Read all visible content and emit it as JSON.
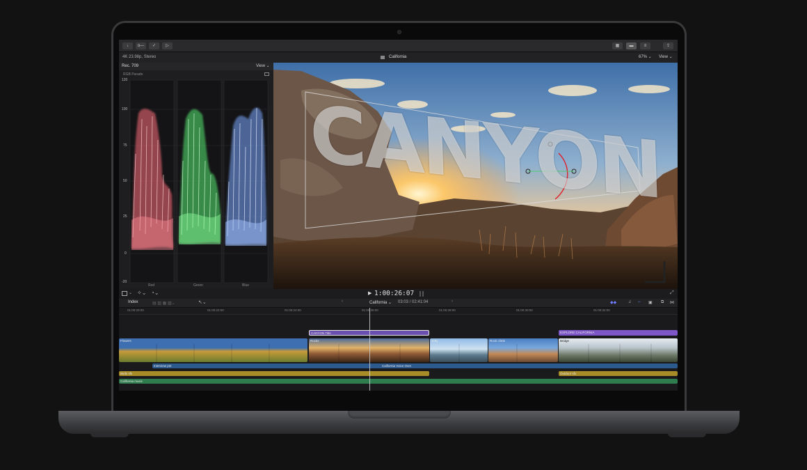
{
  "toolbar": {
    "left_buttons": [
      "↓",
      "o—",
      "✓",
      "▷"
    ],
    "right_buttons": [
      "▦",
      "▬",
      "≡",
      "⇪"
    ]
  },
  "infobar": {
    "format": "4K 23.98p, Stereo",
    "project_name": "California",
    "zoom": "67%",
    "view_label": "View"
  },
  "scope": {
    "colorspace": "Rec. 709",
    "view_label": "View",
    "scope_name": "RGB Parade",
    "y_ticks": [
      "120",
      "100",
      "75",
      "50",
      "25",
      "0",
      "-20"
    ],
    "channels": [
      "Red",
      "Green",
      "Blue"
    ],
    "channel_colors": [
      "#ff6d7a",
      "#5dff7a",
      "#7aa8ff"
    ]
  },
  "viewer": {
    "title_text": "CANYON"
  },
  "transport": {
    "timecode": "1:00:26:07"
  },
  "timeline_bar": {
    "index_label": "Index",
    "project": "California",
    "duration": "03:03 / 02:41:04"
  },
  "ruler": {
    "ticks": [
      "01:00:20:00",
      "01:00:22:00",
      "01:00:24:00",
      "01:00:26:00",
      "01:00:28:00",
      "01:00:30:00",
      "01:00:32:00"
    ]
  },
  "clips": {
    "titles": [
      "CANYON Title",
      "EXPLORE CALIFORNIA"
    ],
    "video": [
      "Flowers",
      "Rocks",
      "Jetty",
      "Rock climb",
      "Bridge"
    ],
    "audio_dialog": [
      "Interview pt2",
      "California Voice Over"
    ],
    "sfx": [
      "Birds sfx",
      "Outdoor sfx"
    ],
    "music": "California music"
  },
  "colors": {
    "title_clip": "#7d56c7",
    "audio_clip": "#2c5a8f",
    "sfx_clip": "#a88c28",
    "music_clip": "#2f7d4e",
    "accent": "#6c7dff"
  }
}
